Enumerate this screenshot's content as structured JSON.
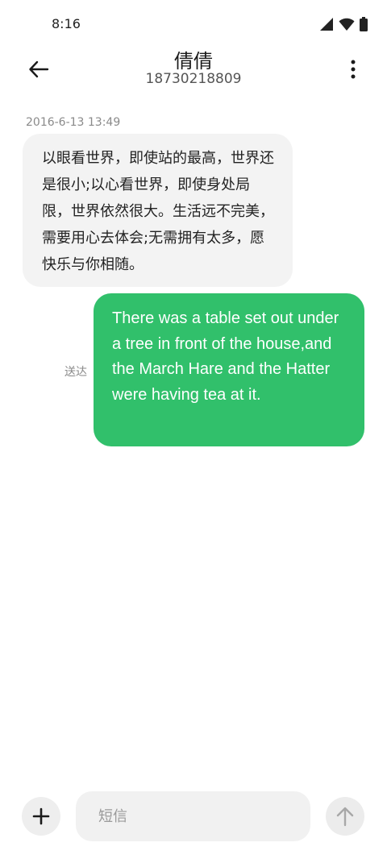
{
  "status_bar": {
    "time": "8:16",
    "icons": [
      "signal-icon",
      "wifi-icon",
      "battery-icon"
    ]
  },
  "header": {
    "contact_name": "倩倩",
    "phone_number": "18730218809",
    "back_icon": "arrow-left-icon",
    "more_icon": "more-vertical-icon"
  },
  "conversation": {
    "timestamp": "2016-6-13 13:49",
    "received_message": "以眼看世界，即使站的最高，世界还是很小;以心看世界，即使身处局限，世界依然很大。生活远不完美，需要用心去体会;无需拥有太多，愿快乐与你相随。",
    "sent_message": "There was a table set out under a tree in front of the house,and the March Hare and the Hatter were having tea at it.",
    "sent_status": "送达"
  },
  "composer": {
    "placeholder": "短信",
    "value": "",
    "add_icon": "plus-icon",
    "send_icon": "arrow-up-icon"
  },
  "colors": {
    "sent_bubble": "#31c06b",
    "received_bubble": "#f3f3f3",
    "background": "#ffffff"
  }
}
